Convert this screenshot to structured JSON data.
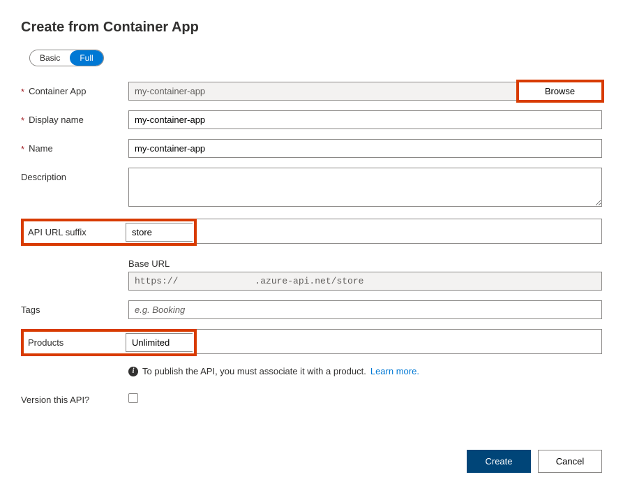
{
  "title": "Create from Container App",
  "mode": {
    "basic": "Basic",
    "full": "Full",
    "active": "full"
  },
  "labels": {
    "containerApp": "Container App",
    "displayName": "Display name",
    "name": "Name",
    "description": "Description",
    "apiUrlSuffix": "API URL suffix",
    "baseUrl": "Base URL",
    "tags": "Tags",
    "products": "Products",
    "versionThisApi": "Version this API?"
  },
  "values": {
    "containerApp": "my-container-app",
    "displayName": "my-container-app",
    "name": "my-container-app",
    "description": "",
    "apiUrlSuffix": "store",
    "baseUrlPrefix": "https://",
    "baseUrlSuffix": ".azure-api.net/store",
    "tags": "",
    "products": "Unlimited",
    "versionChecked": false
  },
  "placeholders": {
    "tags": "e.g. Booking"
  },
  "buttons": {
    "browse": "Browse",
    "create": "Create",
    "cancel": "Cancel"
  },
  "info": {
    "text": "To publish the API, you must associate it with a product.",
    "link": "Learn more"
  }
}
